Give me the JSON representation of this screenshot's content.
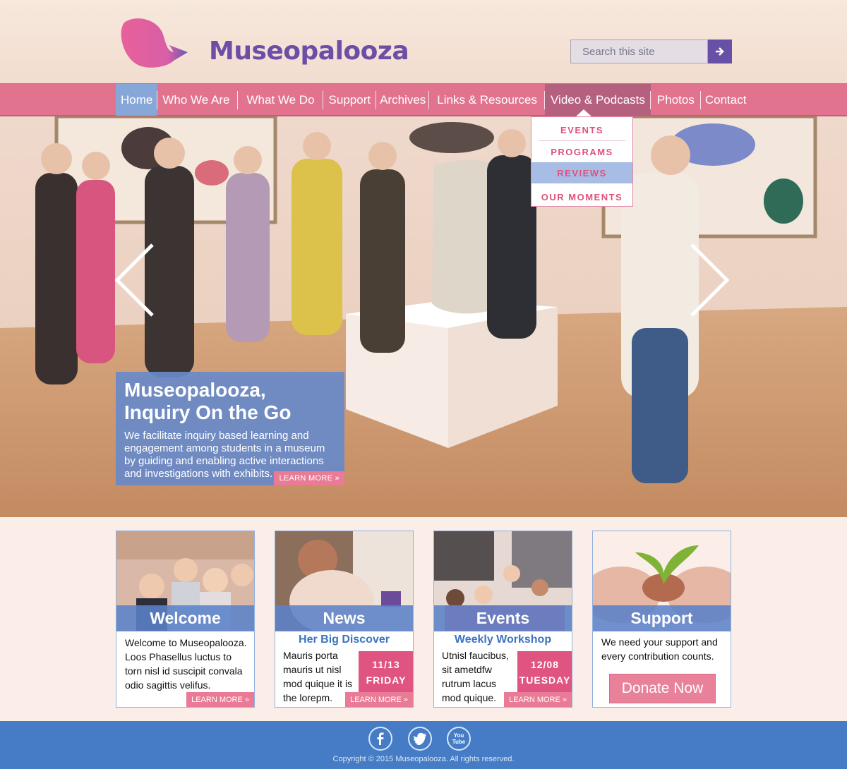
{
  "brand": {
    "name": "Museopalooza",
    "logo_color": "#e05f8e",
    "text_color": "#6c4ea6"
  },
  "search": {
    "placeholder": "Search this site",
    "button_icon": "arrow-right-icon"
  },
  "nav": {
    "items": [
      {
        "label": "Home",
        "state": "active"
      },
      {
        "label": "Who We Are"
      },
      {
        "label": "What We Do"
      },
      {
        "label": "Support"
      },
      {
        "label": "Archives"
      },
      {
        "label": "Links & Resources"
      },
      {
        "label": "Video & Podcasts",
        "state": "open"
      },
      {
        "label": "Photos"
      },
      {
        "label": "Contact"
      }
    ],
    "dropdown": [
      "EVENTS",
      "PROGRAMS",
      "REVIEWS",
      "OUR MOMENTS"
    ],
    "dropdown_highlighted": "REVIEWS"
  },
  "hero": {
    "title": "Museopalooza, Inquiry On the Go",
    "text": "We facilitate inquiry based learning and engagement among students in a museum by guiding and enabling active interactions and investigations with exhibits.",
    "learn_more": "LEARN MORE »",
    "prev_icon": "chevron-left-icon",
    "next_icon": "chevron-right-icon"
  },
  "cards": {
    "welcome": {
      "title": "Welcome",
      "text": "Welcome to Museopalooza. Loos Phasellus luctus to torn nisl id suscipit convala odio sagittis velifus.",
      "learn_more": "LEARN MORE »"
    },
    "news": {
      "title": "News",
      "subhead": "Her Big Discover",
      "text": "Mauris porta mauris ut nisl mod quique it is the lorepm.",
      "date": "11/13",
      "day": "FRIDAY",
      "learn_more": "LEARN MORE »"
    },
    "events": {
      "title": "Events",
      "subhead": "Weekly Workshop",
      "text": "Utnisl faucibus, sit ametdfw rutrum lacus mod quique.",
      "date": "12/08",
      "day": "TUESDAY",
      "learn_more": "LEARN MORE »"
    },
    "support": {
      "title": "Support",
      "text": "We need your support and every contribution counts.",
      "donate": "Donate Now"
    }
  },
  "footer": {
    "social": [
      "facebook-icon",
      "twitter-icon",
      "youtube-icon"
    ],
    "youtube_label": "You Tube",
    "copyright": "Copyright © 2015 Museopalooza. All rights reserved."
  },
  "colors": {
    "nav_bg": "#e2738f",
    "active_blue": "#87a7d8",
    "accent_pink": "#e05481",
    "card_banner": "#5b82c8",
    "footer_bg": "#457cc5"
  }
}
